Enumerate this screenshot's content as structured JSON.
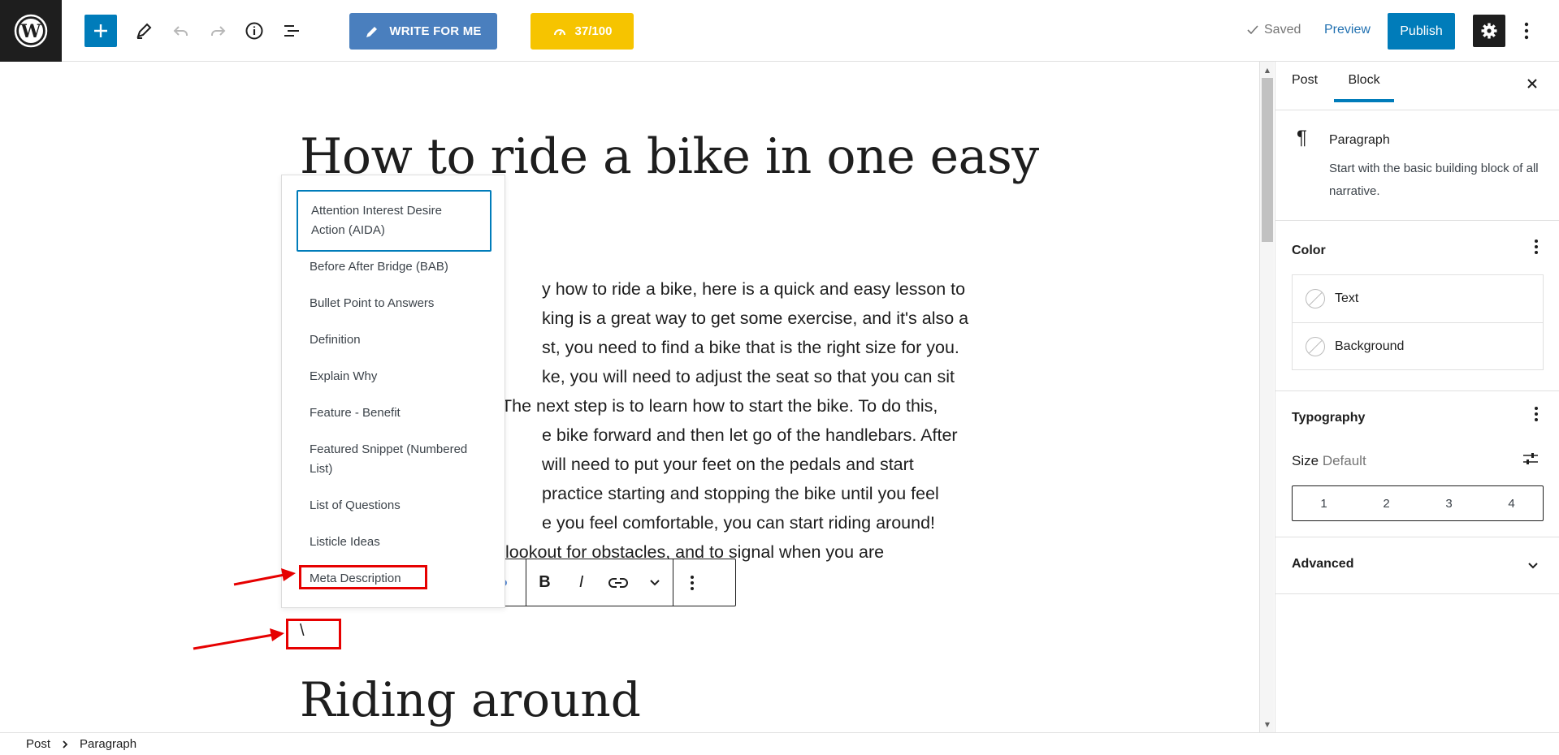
{
  "toolbar": {
    "write_label": "WRITE FOR ME",
    "score_label": "37/100",
    "saved_label": "Saved",
    "preview_label": "Preview",
    "publish_label": "Publish"
  },
  "post": {
    "title": "How to ride a bike in one easy",
    "paragraph_lines": [
      "y how to ride a bike, here is a quick and easy lesson to",
      "king is a great way to get some exercise, and it's also a",
      "st, you need to find a bike that is the right size for you.",
      "ke, you will need to adjust the seat so that you can sit",
      "The next step is to learn how to start the bike. To do this,",
      "e bike forward and then let go of the handlebars. After",
      "will need to put your feet on the pedals and start",
      "practice starting and stopping the bike until you feel",
      "e you feel comfortable, you can start riding around!",
      "lookout for obstacles, and to signal when you are"
    ],
    "slash_text": "\\",
    "heading2": "Riding around"
  },
  "menu": {
    "items": [
      "Attention Interest Desire Action (AIDA)",
      "Before After Bridge (BAB)",
      "Bullet Point to Answers",
      "Definition",
      "Explain Why",
      "Feature - Benefit",
      "Featured Snippet (Numbered List)",
      "List of Questions",
      "Listicle Ideas",
      "Meta Description"
    ],
    "active_index": 0
  },
  "block_toolbar": {
    "bold": "B",
    "italic": "I"
  },
  "sidebar": {
    "tabs": [
      "Post",
      "Block"
    ],
    "active_tab": "Block",
    "block_name": "Paragraph",
    "block_desc": "Start with the basic building block of all narrative.",
    "color_title": "Color",
    "color_text": "Text",
    "color_background": "Background",
    "typography_title": "Typography",
    "size_label": "Size",
    "size_value": "Default",
    "sizes": [
      "1",
      "2",
      "3",
      "4"
    ],
    "advanced_title": "Advanced"
  },
  "breadcrumb": {
    "root": "Post",
    "current": "Paragraph"
  },
  "colors": {
    "accent": "#007cba",
    "write_button": "#4a7fbe",
    "score_button": "#f6c400",
    "annotation": "#e60000"
  },
  "icons": [
    "wordpress-logo",
    "plus-icon",
    "pencil-icon",
    "undo-icon",
    "redo-icon",
    "info-icon",
    "list-view-icon",
    "gauge-icon",
    "check-icon",
    "gear-icon",
    "kebab-icon",
    "close-icon",
    "pilcrow-icon",
    "sliders-icon",
    "chevron-down-icon",
    "link-icon"
  ]
}
